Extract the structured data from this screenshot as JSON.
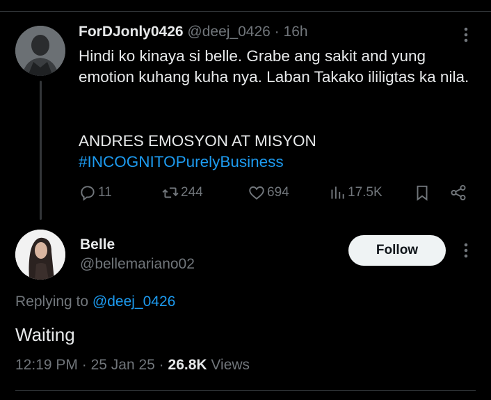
{
  "tweet1": {
    "display_name": "ForDJonly0426",
    "handle": "@deej_0426",
    "separator": "·",
    "time": "16h",
    "body_lines": [
      "Hindi ko kinaya si belle. Grabe ang sakit and yung emotion kuhang kuha nya. Laban Takako ililigtas ka nila."
    ],
    "line_caps": "ANDRES EMOSYON AT MISYON",
    "hashtag": "#INCOGNITOPurelyBusiness",
    "actions": {
      "replies": "11",
      "retweets": "244",
      "likes": "694",
      "views": "17.5K"
    }
  },
  "tweet2": {
    "display_name": "Belle",
    "handle": "@bellemariano02",
    "follow_label": "Follow",
    "replying_prefix": "Replying to",
    "replying_handle": "@deej_0426",
    "text": "Waiting",
    "time": "12:19 PM",
    "date": "25 Jan 25",
    "views_count": "26.8K",
    "views_label": "Views",
    "separator": "·"
  },
  "colors": {
    "background": "#000000",
    "text": "#e7e9ea",
    "muted": "#71767b",
    "link": "#1d9bf0",
    "follow_bg": "#eff3f4"
  },
  "icons": [
    "more-icon",
    "reply-icon",
    "retweet-icon",
    "like-icon",
    "views-icon",
    "bookmark-icon",
    "share-icon"
  ]
}
